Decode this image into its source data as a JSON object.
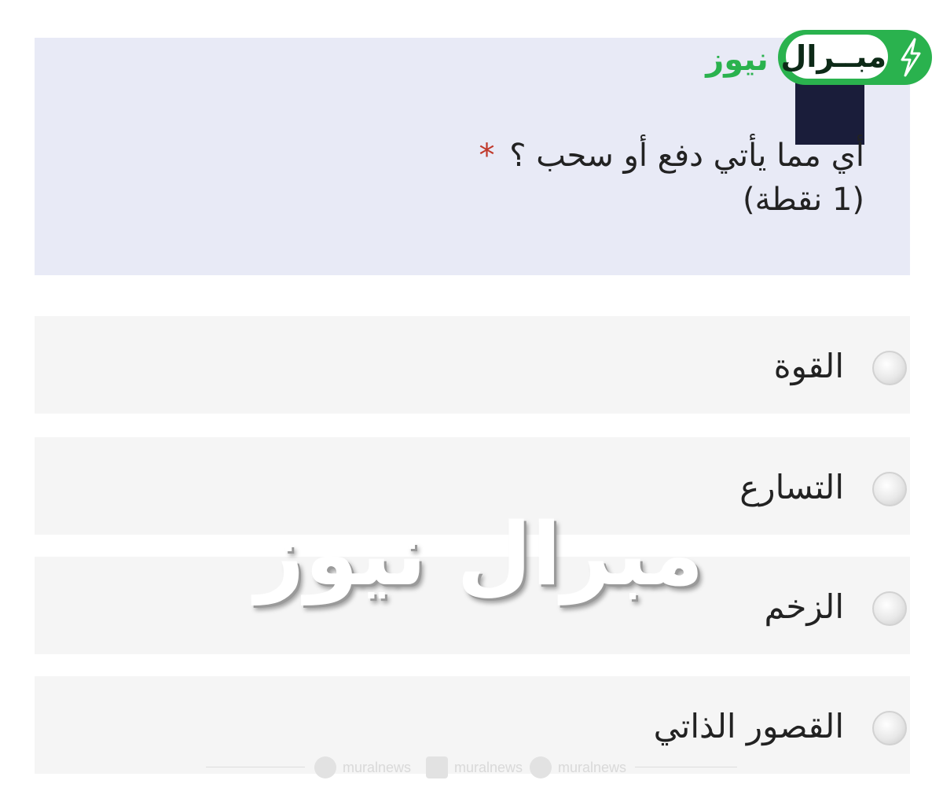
{
  "brand": {
    "logo_part1": "مبــرال",
    "logo_part2": "نيوز",
    "accent_color": "#2ab24e"
  },
  "question": {
    "text": "أي مما يأتي دفع أو سحب ؟",
    "required_mark": "*",
    "points": "(1 نقطة)"
  },
  "options": [
    {
      "label": "القوة"
    },
    {
      "label": "التسارع"
    },
    {
      "label": "الزخم"
    },
    {
      "label": "القصور الذاتي"
    }
  ],
  "watermark": {
    "text": "مبرال نيوز"
  },
  "social": [
    {
      "icon": "telegram-icon",
      "handle": "muralnews"
    },
    {
      "icon": "twitter-icon",
      "handle": "muralnews"
    },
    {
      "icon": "pinterest-icon",
      "handle": "muralnews"
    }
  ]
}
